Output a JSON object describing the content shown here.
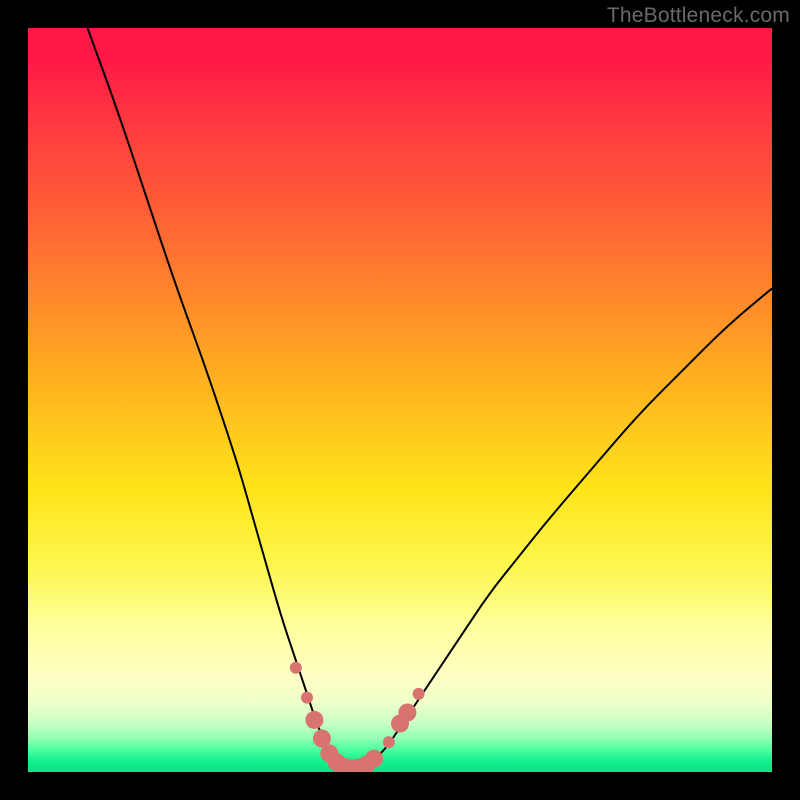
{
  "watermark": "TheBottleneck.com",
  "chart_data": {
    "type": "line",
    "title": "",
    "xlabel": "",
    "ylabel": "",
    "xlim": [
      0,
      100
    ],
    "ylim": [
      0,
      100
    ],
    "grid": false,
    "legend": false,
    "annotations": [],
    "series": [
      {
        "name": "bottleneck-curve",
        "x": [
          8,
          12,
          16,
          20,
          24,
          28,
          30,
          32,
          34,
          36,
          38,
          39,
          40,
          41,
          42,
          43,
          44,
          45,
          46,
          48,
          50,
          54,
          58,
          62,
          66,
          70,
          76,
          82,
          88,
          94,
          100
        ],
        "y": [
          100,
          89,
          77,
          65,
          54,
          42,
          35,
          28,
          21,
          15,
          9,
          6,
          4,
          2,
          1,
          0.6,
          0.4,
          0.7,
          1.3,
          3,
          6,
          12,
          18,
          24,
          29,
          34,
          41,
          48,
          54,
          60,
          65
        ]
      }
    ],
    "markers": {
      "name": "optimum-points",
      "points": [
        {
          "x": 36.0,
          "y": 14.0,
          "r": "sm"
        },
        {
          "x": 37.5,
          "y": 10.0,
          "r": "sm"
        },
        {
          "x": 38.5,
          "y": 7.0,
          "r": "lg"
        },
        {
          "x": 39.5,
          "y": 4.5,
          "r": "lg"
        },
        {
          "x": 40.5,
          "y": 2.5,
          "r": "lg"
        },
        {
          "x": 41.5,
          "y": 1.3,
          "r": "lg"
        },
        {
          "x": 42.5,
          "y": 0.7,
          "r": "lg"
        },
        {
          "x": 43.5,
          "y": 0.5,
          "r": "lg"
        },
        {
          "x": 44.5,
          "y": 0.6,
          "r": "lg"
        },
        {
          "x": 45.5,
          "y": 1.0,
          "r": "lg"
        },
        {
          "x": 46.5,
          "y": 1.8,
          "r": "lg"
        },
        {
          "x": 48.5,
          "y": 4.0,
          "r": "sm"
        },
        {
          "x": 50.0,
          "y": 6.5,
          "r": "lg"
        },
        {
          "x": 51.0,
          "y": 8.0,
          "r": "lg"
        },
        {
          "x": 52.5,
          "y": 10.5,
          "r": "sm"
        }
      ],
      "radius_sm": 6,
      "radius_lg": 9,
      "color": "#d9736f"
    },
    "gradient_stops": [
      {
        "pos": 0,
        "color": "#ff1846"
      },
      {
        "pos": 28,
        "color": "#ff6a33"
      },
      {
        "pos": 62,
        "color": "#ffe41a"
      },
      {
        "pos": 87,
        "color": "#ffffc4"
      },
      {
        "pos": 100,
        "color": "#0be184"
      }
    ]
  }
}
